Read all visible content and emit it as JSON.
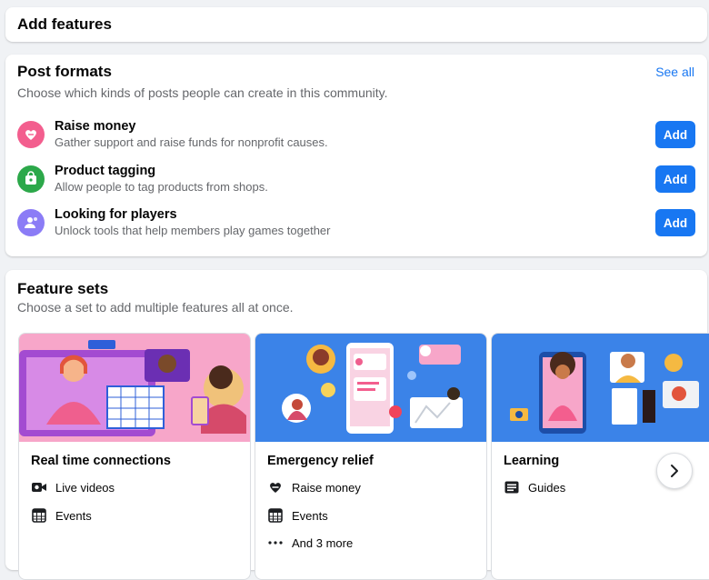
{
  "header": {
    "title": "Add features"
  },
  "post_formats": {
    "title": "Post formats",
    "see_all": "See all",
    "subtitle": "Choose which kinds of posts people can create in this community.",
    "items": [
      {
        "title": "Raise money",
        "description": "Gather support and raise funds for nonprofit causes.",
        "button": "Add",
        "icon": "heart-hand-icon",
        "icon_color": "#f35e8e"
      },
      {
        "title": "Product tagging",
        "description": "Allow people to tag products from shops.",
        "button": "Add",
        "icon": "shopping-tag-icon",
        "icon_color": "#2ca84a"
      },
      {
        "title": "Looking for players",
        "description": "Unlock tools that help members play games together",
        "button": "Add",
        "icon": "players-icon",
        "icon_color": "#8b7cf6"
      }
    ]
  },
  "feature_sets": {
    "title": "Feature sets",
    "subtitle": "Choose a set to add multiple features all at once.",
    "sets": [
      {
        "name": "Real time connections",
        "features": [
          {
            "label": "Live videos",
            "icon": "video-camera-icon"
          },
          {
            "label": "Events",
            "icon": "calendar-icon"
          }
        ]
      },
      {
        "name": "Emergency relief",
        "features": [
          {
            "label": "Raise money",
            "icon": "heart-hand-icon"
          },
          {
            "label": "Events",
            "icon": "calendar-icon"
          },
          {
            "label": "And 3 more",
            "icon": "more-icon"
          }
        ]
      },
      {
        "name": "Learning",
        "features": [
          {
            "label": "Guides",
            "icon": "guide-icon"
          }
        ]
      }
    ],
    "next_button_icon": "chevron-right-icon"
  },
  "colors": {
    "accent": "#1877f2",
    "pink_banner": "#f7a6c9",
    "blue_banner": "#3b83e8"
  }
}
